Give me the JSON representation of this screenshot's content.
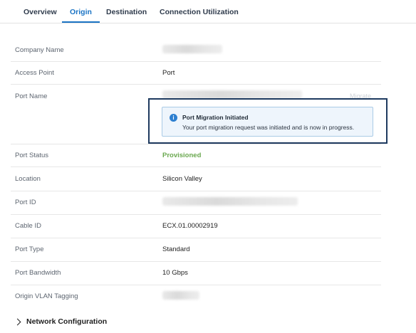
{
  "tabs": [
    {
      "label": "Overview",
      "active": false
    },
    {
      "label": "Origin",
      "active": true
    },
    {
      "label": "Destination",
      "active": false
    },
    {
      "label": "Connection Utilization",
      "active": false
    }
  ],
  "rows": {
    "company_name": {
      "label": "Company Name",
      "value": ""
    },
    "access_point": {
      "label": "Access Point",
      "value": "Port"
    },
    "port_name": {
      "label": "Port Name",
      "value": "",
      "action": "Migrate"
    },
    "port_status": {
      "label": "Port Status",
      "value": "Provisioned"
    },
    "location": {
      "label": "Location",
      "value": "Silicon Valley"
    },
    "port_id": {
      "label": "Port ID",
      "value": ""
    },
    "cable_id": {
      "label": "Cable ID",
      "value": "ECX.01.00002919"
    },
    "port_type": {
      "label": "Port Type",
      "value": "Standard"
    },
    "port_bandwidth": {
      "label": "Port Bandwidth",
      "value": "10 Gbps"
    },
    "origin_vlan_tagging": {
      "label": "Origin VLAN Tagging",
      "value": ""
    }
  },
  "alert": {
    "icon": "info-icon",
    "title": "Port Migration Initiated",
    "message": "Your port migration request was initiated and is now in progress.",
    "highlight_color": "#1e3a5f"
  },
  "network_configuration": {
    "label": "Network Configuration",
    "expanded": false
  },
  "colors": {
    "accent": "#1b74c4",
    "status_provisioned": "#6aa84f"
  }
}
